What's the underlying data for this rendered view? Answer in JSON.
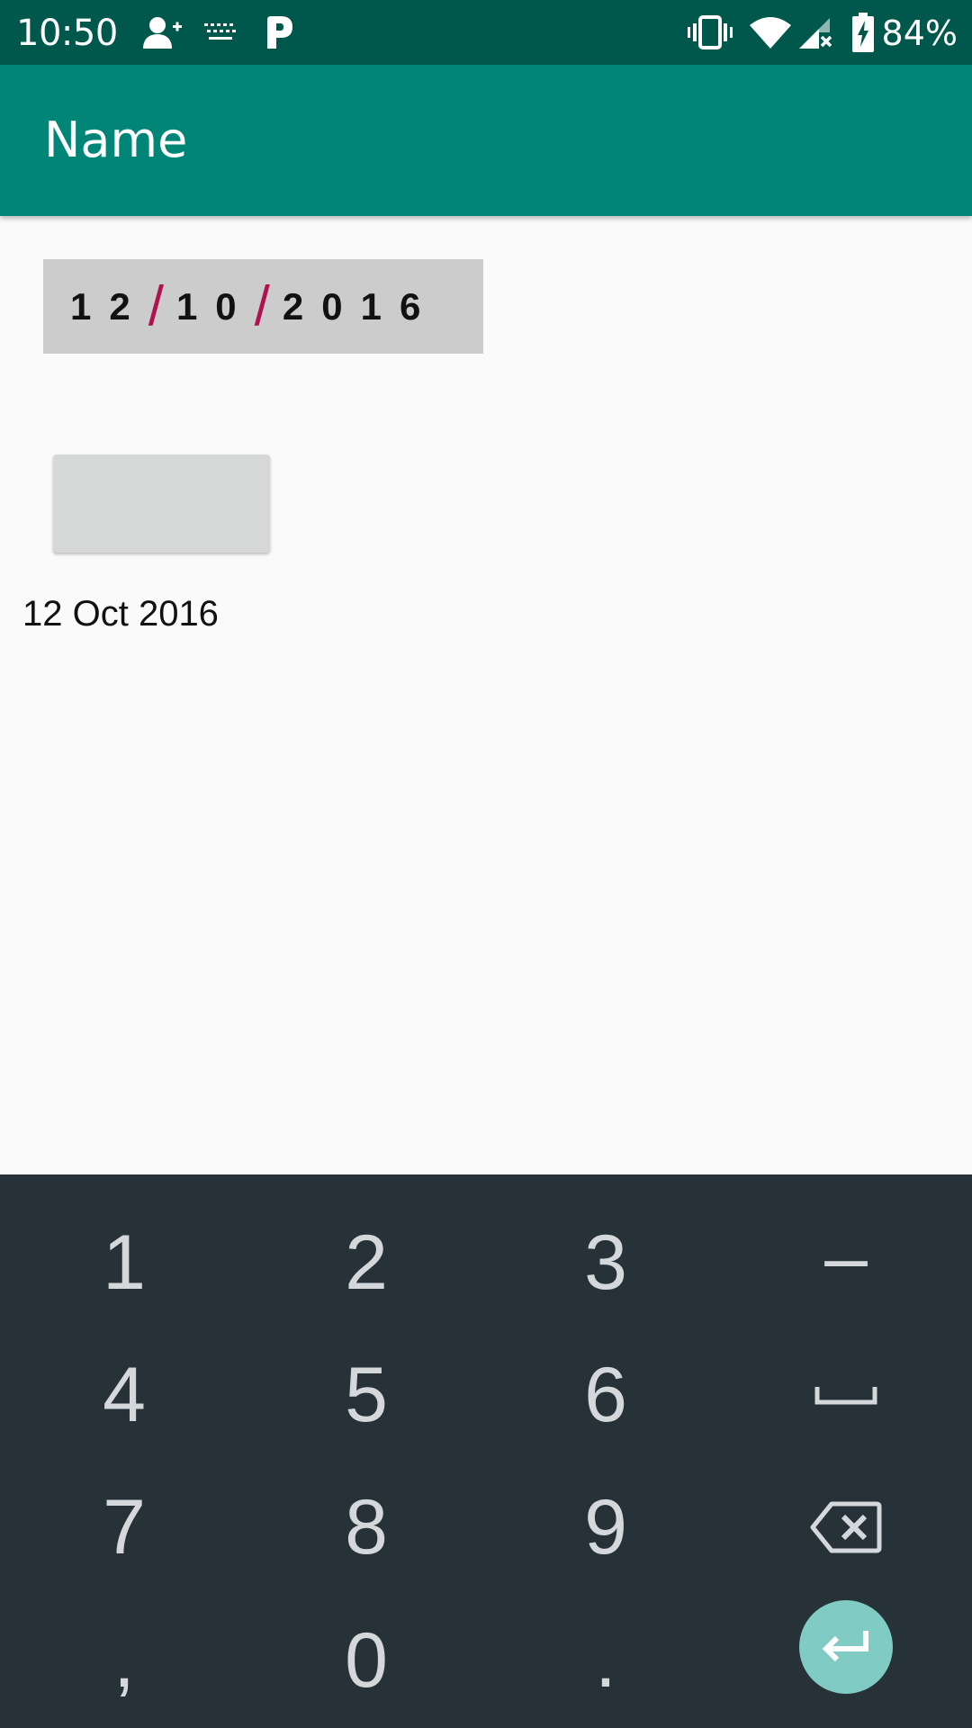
{
  "status_bar": {
    "time": "10:50",
    "battery_percent": "84%",
    "icons": [
      "add-person-icon",
      "keyboard-icon",
      "p-app-icon",
      "vibrate-icon",
      "wifi-icon",
      "no-signal-icon",
      "battery-charging-icon"
    ]
  },
  "app_bar": {
    "title": "Name"
  },
  "date_field": {
    "day": "12",
    "month": "10",
    "year": "2016",
    "separator": "/"
  },
  "button": {
    "label": ""
  },
  "date_text": "12 Oct 2016",
  "keyboard": {
    "row1": [
      "1",
      "2",
      "3",
      "–"
    ],
    "row2": [
      "4",
      "5",
      "6"
    ],
    "row3": [
      "7",
      "8",
      "9"
    ],
    "row4": [
      ",",
      "0",
      "."
    ],
    "icons": [
      "space-icon",
      "backspace-icon",
      "enter-icon"
    ]
  },
  "colors": {
    "status_bar": "#00574b",
    "app_bar": "#008577",
    "keyboard": "#263238",
    "separator": "#b0124f",
    "enter_key": "#80cbc4"
  }
}
